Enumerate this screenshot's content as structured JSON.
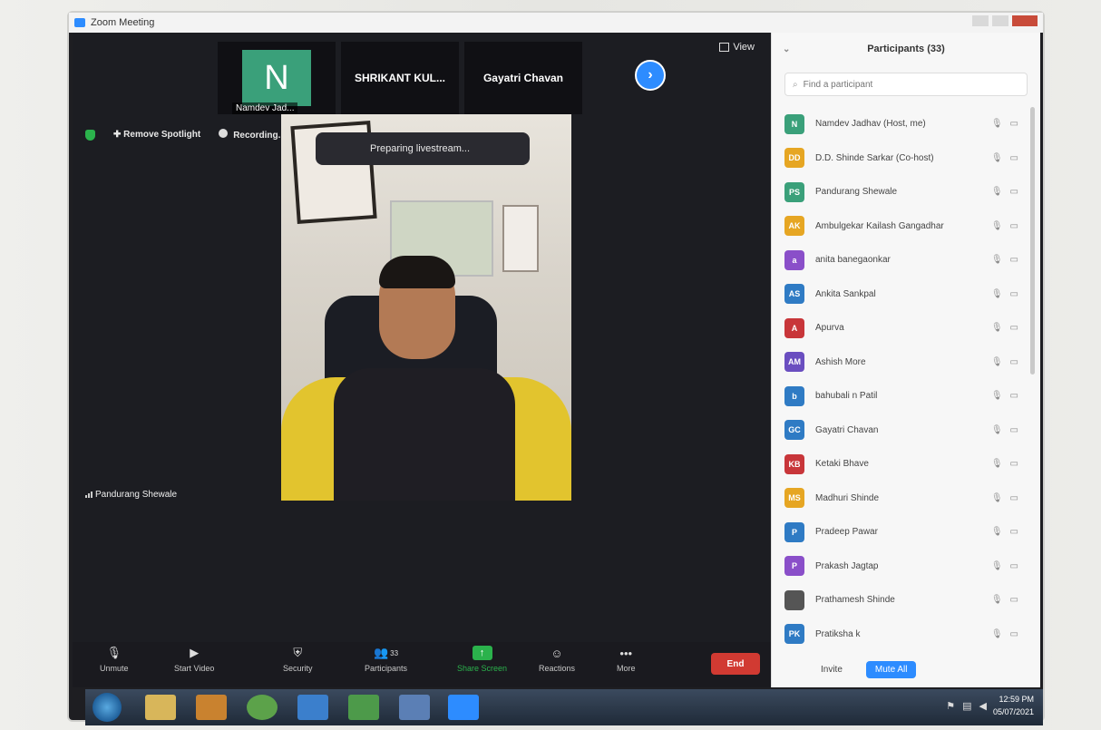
{
  "window": {
    "title": "Zoom Meeting"
  },
  "gallery": {
    "tiles": [
      {
        "initial": "N",
        "name": "Namdev Jad..."
      },
      {
        "name": "SHRIKANT KUL..."
      },
      {
        "name": "Gayatri Chavan"
      }
    ],
    "view_label": "View"
  },
  "top_actions": {
    "remove_spotlight": "Remove Spotlight",
    "recording": "Recording..."
  },
  "toast": "Preparing livestream...",
  "active_speaker": "Pandurang Shewale",
  "toolbar": {
    "unmute": "Unmute",
    "start_video": "Start Video",
    "security": "Security",
    "participants": "Participants",
    "participants_count": "33",
    "share_screen": "Share Screen",
    "reactions": "Reactions",
    "more": "More",
    "end": "End"
  },
  "panel": {
    "title": "Participants (33)",
    "search_placeholder": "Find a participant",
    "participants": [
      {
        "initials": "N",
        "name": "Namdev Jadhav (Host, me)",
        "color": "#3aa07a"
      },
      {
        "initials": "DD",
        "name": "D.D. Shinde Sarkar (Co-host)",
        "color": "#e6a623"
      },
      {
        "initials": "PS",
        "name": "Pandurang Shewale",
        "color": "#3aa07a"
      },
      {
        "initials": "AK",
        "name": "Ambulgekar Kailash Gangadhar",
        "color": "#e6a623"
      },
      {
        "initials": "a",
        "name": "anita banegaonkar",
        "color": "#8a4fc9"
      },
      {
        "initials": "AS",
        "name": "Ankita Sankpal",
        "color": "#2f7bc4"
      },
      {
        "initials": "A",
        "name": "Apurva",
        "color": "#c8363a"
      },
      {
        "initials": "AM",
        "name": "Ashish More",
        "color": "#6a4ec0"
      },
      {
        "initials": "b",
        "name": "bahubali n Patil",
        "color": "#2f7bc4"
      },
      {
        "initials": "GC",
        "name": "Gayatri Chavan",
        "color": "#2f7bc4"
      },
      {
        "initials": "KB",
        "name": "Ketaki Bhave",
        "color": "#c8363a"
      },
      {
        "initials": "MS",
        "name": "Madhuri Shinde",
        "color": "#e6a623"
      },
      {
        "initials": "P",
        "name": "Pradeep Pawar",
        "color": "#2f7bc4"
      },
      {
        "initials": "P",
        "name": "Prakash Jagtap",
        "color": "#8a4fc9"
      },
      {
        "initials": "",
        "name": "Prathamesh Shinde",
        "color": "#555555"
      },
      {
        "initials": "PK",
        "name": "Pratiksha k",
        "color": "#2f7bc4"
      }
    ],
    "invite": "Invite",
    "mute_all": "Mute All"
  },
  "taskbar": {
    "time": "12:59 PM",
    "date": "05/07/2021"
  }
}
